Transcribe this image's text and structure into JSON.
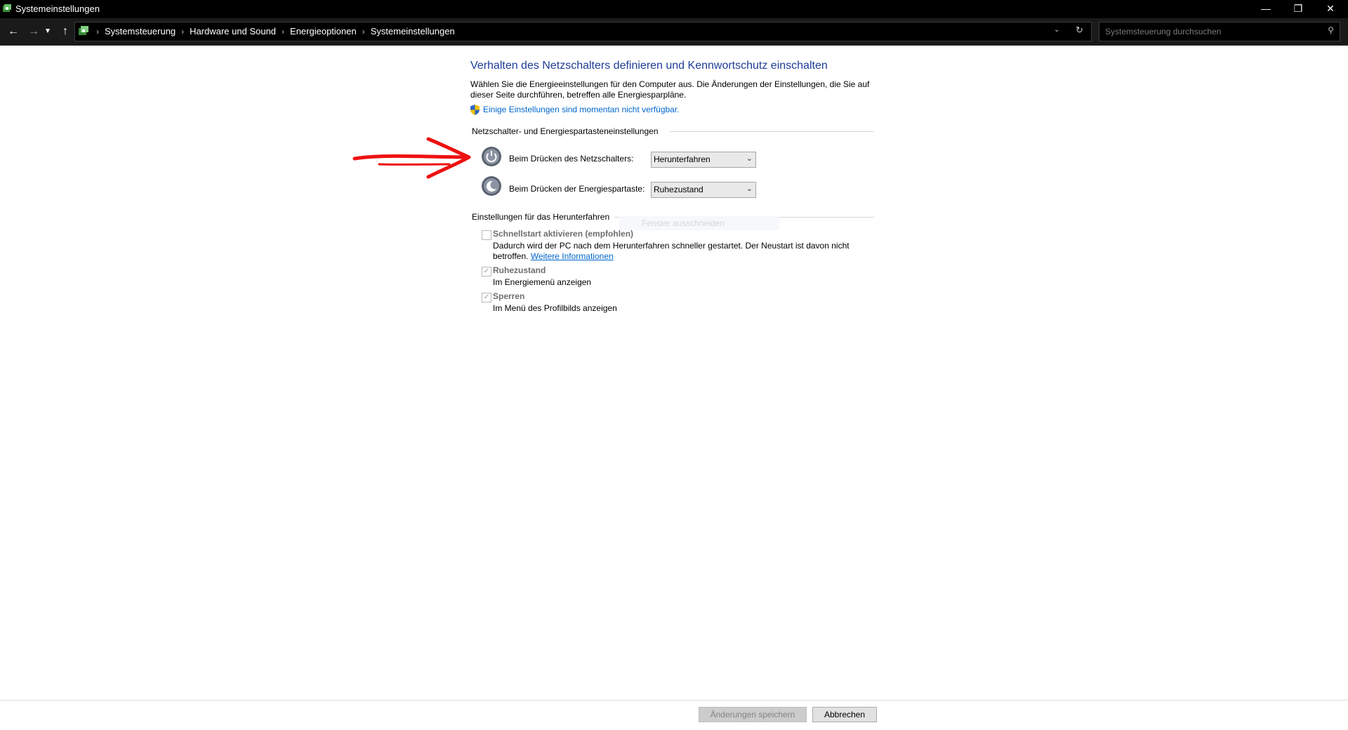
{
  "window": {
    "title": "Systemeinstellungen"
  },
  "breadcrumbs": [
    "Systemsteuerung",
    "Hardware und Sound",
    "Energieoptionen",
    "Systemeinstellungen"
  ],
  "search": {
    "placeholder": "Systemsteuerung durchsuchen"
  },
  "main": {
    "heading": "Verhalten des Netzschalters definieren und Kennwortschutz einschalten",
    "description": "Wählen Sie die Energieeinstellungen für den Computer aus. Die Änderungen der Einstellungen, die Sie auf dieser Seite durchführen, betreffen alle Energiesparpläne.",
    "uac_link": "Einige Einstellungen sind momentan nicht verfügbar.",
    "power_section": {
      "title": "Netzschalter- und Energiespartasteneinstellungen",
      "power_button_label": "Beim Drücken des Netzschalters:",
      "power_button_value": "Herunterfahren",
      "sleep_button_label": "Beim Drücken der Energiespartaste:",
      "sleep_button_value": "Ruhezustand"
    },
    "shutdown_section": {
      "title": "Einstellungen für das Herunterfahren",
      "fast_startup_label": "Schnellstart aktivieren (empfohlen)",
      "fast_startup_checked": false,
      "fast_startup_desc_1": "Dadurch wird der PC nach dem Herunterfahren schneller gestartet. Der Neustart ist davon nicht",
      "fast_startup_desc_2": "betroffen.",
      "more_info_link": "Weitere Informationen",
      "hibernate_label": "Ruhezustand",
      "hibernate_checked": true,
      "hibernate_desc": "Im Energiemenü anzeigen",
      "lock_label": "Sperren",
      "lock_checked": true,
      "lock_desc": "Im Menü des Profilbilds anzeigen"
    },
    "ghost_tooltip": "Fenster ausschneiden"
  },
  "footer": {
    "save_label": "Änderungen speichern",
    "cancel_label": "Abbrechen"
  },
  "icons": {
    "back": "arrow-left-icon",
    "forward": "arrow-right-icon",
    "recent": "chevron-down-icon",
    "up": "arrow-up-icon",
    "refresh": "refresh-icon",
    "search": "search-icon",
    "uac": "shield-icon",
    "power": "power-icon",
    "sleep": "moon-icon"
  },
  "colors": {
    "heading": "#1e3c96",
    "link": "#0066cc",
    "annotation": "#ee1111"
  }
}
